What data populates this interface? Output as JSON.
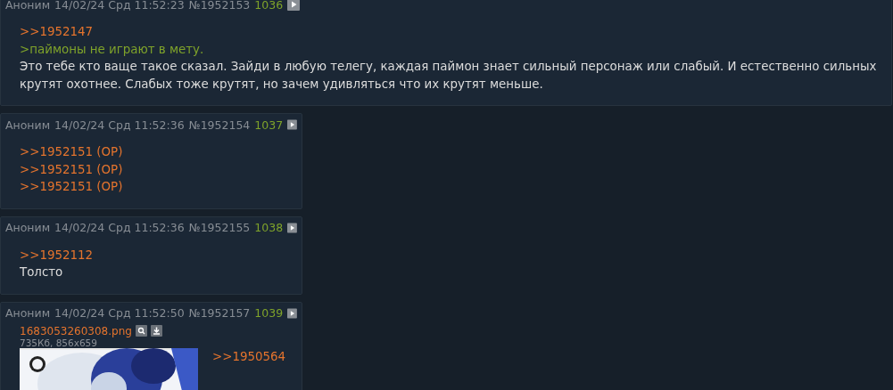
{
  "posts": [
    {
      "name": "Аноним",
      "date": "14/02/24 Срд 11:52:23",
      "number": "№1952153",
      "index": "1036",
      "wide": true,
      "lines": [
        {
          "kind": "reply",
          "text": ">>1952147"
        },
        {
          "kind": "quote",
          "text": ">паймоны не играют в мету."
        },
        {
          "kind": "text",
          "text": "Это тебе кто ваще такое сказал. Зайди в любую телегу, каждая паймон знает сильный персонаж или слабый. И естественно сильных крутят охотнее. Слабых тоже крутят, но зачем удивляться что их крутят меньше."
        }
      ]
    },
    {
      "name": "Аноним",
      "date": "14/02/24 Срд 11:52:36",
      "number": "№1952154",
      "index": "1037",
      "wide": false,
      "lines": [
        {
          "kind": "reply",
          "text": ">>1952151 (OP)"
        },
        {
          "kind": "reply",
          "text": ">>1952151 (OP)"
        },
        {
          "kind": "reply",
          "text": ">>1952151 (OP)"
        }
      ]
    },
    {
      "name": "Аноним",
      "date": "14/02/24 Срд 11:52:36",
      "number": "№1952155",
      "index": "1038",
      "wide": false,
      "lines": [
        {
          "kind": "reply",
          "text": ">>1952112"
        },
        {
          "kind": "text",
          "text": "Толсто"
        }
      ]
    },
    {
      "name": "Аноним",
      "date": "14/02/24 Срд 11:52:50",
      "number": "№1952157",
      "index": "1039",
      "wide": false,
      "file": {
        "filename": "1683053260308.png",
        "meta": "735Кб, 856x659",
        "kind": "picture"
      },
      "lines": [
        {
          "kind": "reply",
          "text": ">>1950564"
        }
      ]
    }
  ]
}
